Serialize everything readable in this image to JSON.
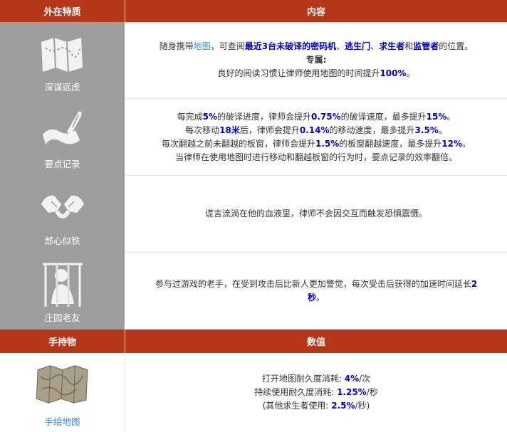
{
  "header": {
    "col1": "外在特质",
    "col2": "内容"
  },
  "traits": [
    {
      "label": "深谋远虑",
      "icon": "map-icon",
      "lines": [
        [
          {
            "t": "随身携带"
          },
          {
            "t": "地图",
            "s": "link"
          },
          {
            "t": "，可查阅"
          },
          {
            "t": "最近3台未破译的密码机",
            "s": "blue"
          },
          {
            "t": "、"
          },
          {
            "t": "逃生门",
            "s": "blue"
          },
          {
            "t": "、"
          },
          {
            "t": "求生者",
            "s": "blue"
          },
          {
            "t": "和"
          },
          {
            "t": "监管者",
            "s": "blue"
          },
          {
            "t": "的位置。"
          }
        ],
        [
          {
            "t": "专属:",
            "s": "bold"
          }
        ],
        [
          {
            "t": "良好的阅读习惯让律师使用地图的时间提升"
          },
          {
            "t": "100%",
            "s": "blue"
          },
          {
            "t": "。"
          }
        ]
      ]
    },
    {
      "label": "要点记录",
      "icon": "quill-scroll-icon",
      "lines": [
        [
          {
            "t": "每完成"
          },
          {
            "t": "5%",
            "s": "blue"
          },
          {
            "t": "的破译进度，律师会提升"
          },
          {
            "t": "0.75%",
            "s": "blue"
          },
          {
            "t": "的破译速度，最多提升"
          },
          {
            "t": "15%",
            "s": "blue"
          },
          {
            "t": "。"
          }
        ],
        [
          {
            "t": "每次移动"
          },
          {
            "t": "18米",
            "s": "blue"
          },
          {
            "t": "后，律师会提升"
          },
          {
            "t": "0.14%",
            "s": "blue"
          },
          {
            "t": "的移动速度，最多提升"
          },
          {
            "t": "3.5%",
            "s": "blue"
          },
          {
            "t": "。"
          }
        ],
        [
          {
            "t": "每次翻越之前未翻越的板窗，律师会提升"
          },
          {
            "t": "1.5%",
            "s": "blue"
          },
          {
            "t": "的板窗翻越速度，最多提升"
          },
          {
            "t": "12%",
            "s": "blue"
          },
          {
            "t": "。"
          }
        ],
        [
          {
            "t": "当律师在使用地图时进行移动和翻越板窗的行为时，要点记录的效率翻倍。"
          }
        ]
      ]
    },
    {
      "label": "郎心似铁",
      "icon": "handshake-icon",
      "lines": [
        [
          {
            "t": "谎言流淌在他的血液里，律师不会因交互而触发恐惧震慑。"
          }
        ]
      ]
    },
    {
      "label": "庄园老友",
      "icon": "prisoner-bars-icon",
      "lines": [
        [
          {
            "t": "参与过游戏的老手，在受到攻击后比新人更加警觉，每次受击后获得的加速时间延长"
          },
          {
            "t": "2",
            "s": "blue"
          }
        ],
        [
          {
            "t": "秒",
            "s": "blue"
          },
          {
            "t": "。"
          }
        ]
      ]
    }
  ],
  "item_header": {
    "col1": "手持物",
    "col2": "数值"
  },
  "item": {
    "label": "手绘地图",
    "icon": "folded-map-icon",
    "lines": [
      [
        {
          "t": "打开地图耐久度消耗: "
        },
        {
          "t": "4%",
          "s": "blue"
        },
        {
          "t": "/次"
        }
      ],
      [
        {
          "t": "持续使用耐久度消耗: "
        },
        {
          "t": "1.25%",
          "s": "blue"
        },
        {
          "t": "/秒"
        }
      ],
      [
        {
          "t": "(其他求生者使用: "
        },
        {
          "t": "2.5%",
          "s": "blue"
        },
        {
          "t": "/秒)"
        }
      ]
    ]
  },
  "colors": {
    "header_bg": "#b4371a",
    "icon_bg": "#9e9e9e",
    "highlight": "#0000cc",
    "link": "#1e90ff"
  }
}
